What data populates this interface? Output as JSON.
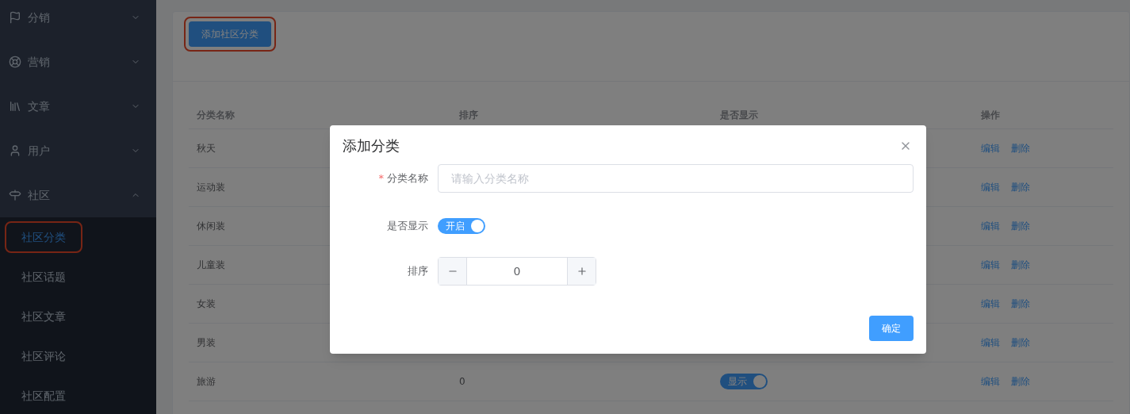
{
  "sidebar": {
    "items": [
      {
        "label": "分销",
        "expanded": false
      },
      {
        "label": "营销",
        "expanded": false
      },
      {
        "label": "文章",
        "expanded": false
      },
      {
        "label": "用户",
        "expanded": false
      },
      {
        "label": "社区",
        "expanded": true,
        "children": [
          {
            "label": "社区分类",
            "selected": true
          },
          {
            "label": "社区话题",
            "selected": false
          },
          {
            "label": "社区文章",
            "selected": false
          },
          {
            "label": "社区评论",
            "selected": false
          },
          {
            "label": "社区配置",
            "selected": false
          }
        ]
      }
    ]
  },
  "toolbar": {
    "add_button": "添加社区分类"
  },
  "table": {
    "columns": [
      "分类名称",
      "排序",
      "是否显示",
      "操作"
    ],
    "rows": [
      {
        "name": "秋天",
        "actions": [
          "编辑",
          "删除"
        ]
      },
      {
        "name": "运动装",
        "actions": [
          "编辑",
          "删除"
        ]
      },
      {
        "name": "休闲装",
        "actions": [
          "编辑",
          "删除"
        ]
      },
      {
        "name": "儿童装",
        "actions": [
          "编辑",
          "删除"
        ]
      },
      {
        "name": "女装",
        "actions": [
          "编辑",
          "删除"
        ]
      },
      {
        "name": "男装",
        "actions": [
          "编辑",
          "删除"
        ]
      },
      {
        "name": "旅游",
        "sort": "0",
        "display": {
          "label": "显示",
          "on": true
        },
        "actions": [
          "编辑",
          "删除"
        ]
      }
    ]
  },
  "dialog": {
    "title": "添加分类",
    "name_field": {
      "label": "分类名称",
      "required_mark": "*",
      "placeholder": "请输入分类名称"
    },
    "display_field": {
      "label": "是否显示",
      "switch": {
        "label": "开启",
        "on": true
      }
    },
    "sort_field": {
      "label": "排序",
      "value": "0"
    },
    "confirm_button": "确定"
  }
}
